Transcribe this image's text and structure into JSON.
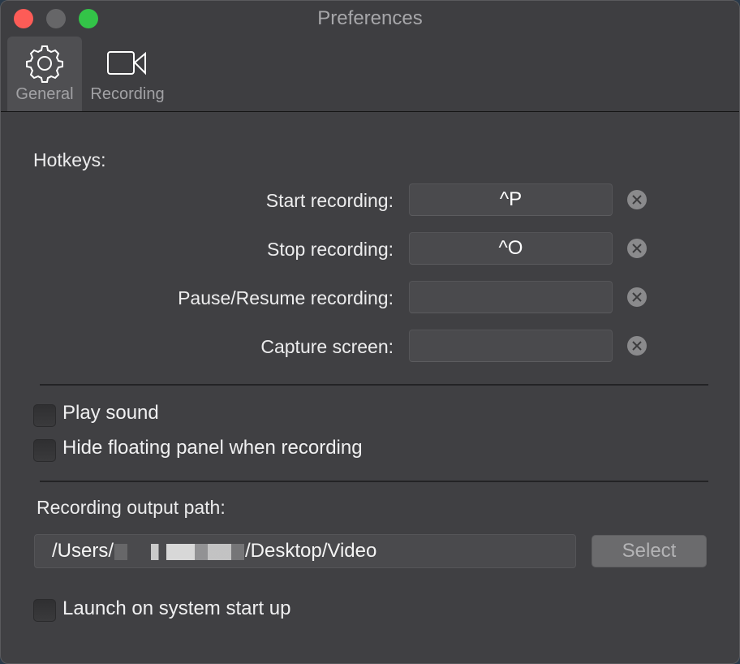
{
  "window": {
    "title": "Preferences",
    "traffic_lights": {
      "close": "#fd5c57",
      "minimize": "#666668",
      "maximize": "#33c448"
    }
  },
  "toolbar": {
    "tabs": [
      {
        "label": "General",
        "icon": "gear-icon",
        "active": true
      },
      {
        "label": "Recording",
        "icon": "video-camera-icon",
        "active": false
      }
    ]
  },
  "hotkeys": {
    "section_label": "Hotkeys:",
    "rows": [
      {
        "label": "Start recording:",
        "value": "^P"
      },
      {
        "label": "Stop recording:",
        "value": "^O"
      },
      {
        "label": "Pause/Resume recording:",
        "value": ""
      },
      {
        "label": "Capture screen:",
        "value": ""
      }
    ],
    "clear_icon": "clear-circle-x-icon"
  },
  "options": {
    "play_sound": {
      "label": "Play sound",
      "checked": false
    },
    "hide_floating_panel": {
      "label": "Hide floating panel when recording",
      "checked": false
    }
  },
  "output": {
    "label": "Recording output path:",
    "path_prefix": "/Users/",
    "path_suffix": "/Desktop/Video",
    "select_label": "Select"
  },
  "launch": {
    "label": "Launch on system start up",
    "checked": false
  }
}
